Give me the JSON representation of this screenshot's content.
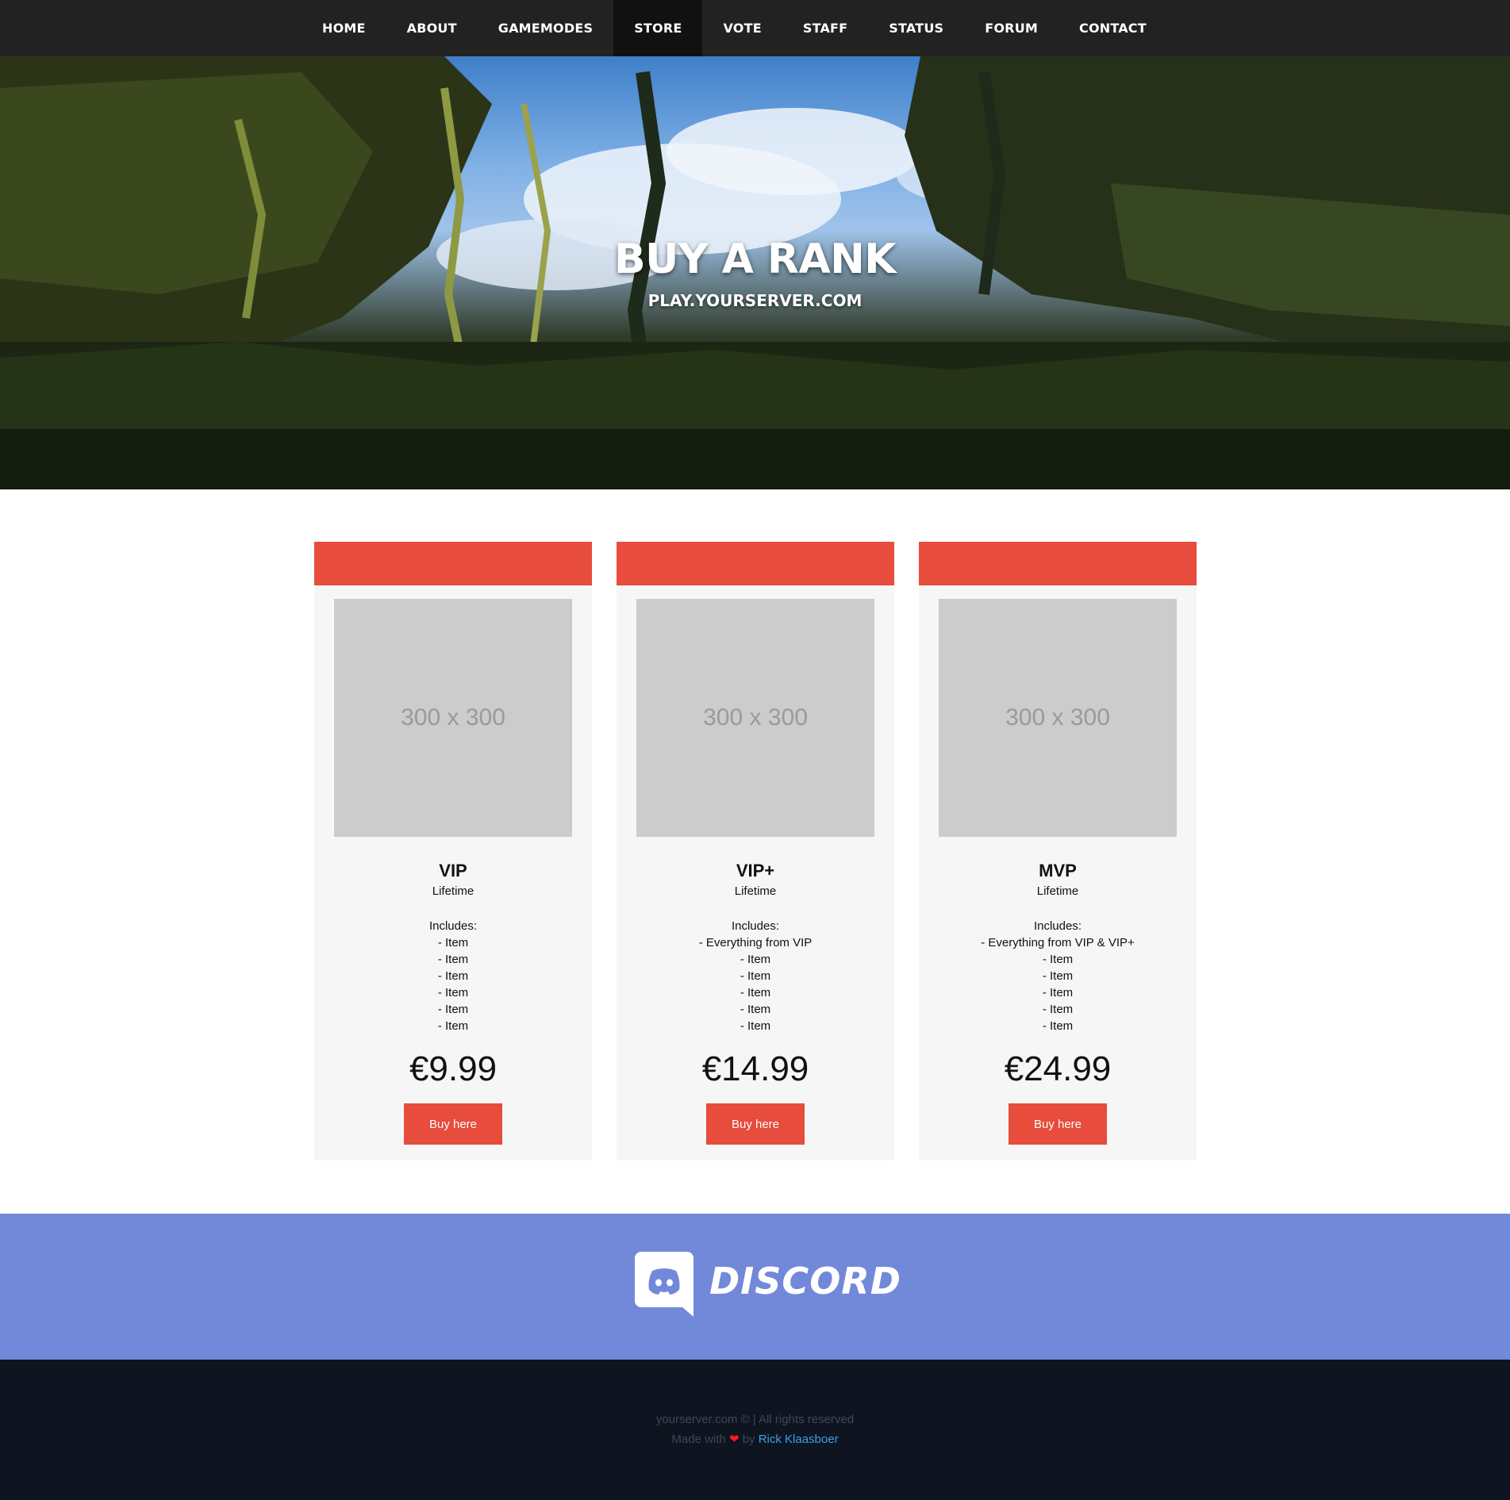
{
  "nav": {
    "items": [
      {
        "label": "HOME"
      },
      {
        "label": "ABOUT"
      },
      {
        "label": "GAMEMODES"
      },
      {
        "label": "STORE"
      },
      {
        "label": "VOTE"
      },
      {
        "label": "STAFF"
      },
      {
        "label": "STATUS"
      },
      {
        "label": "FORUM"
      },
      {
        "label": "CONTACT"
      }
    ],
    "active": "STORE"
  },
  "hero": {
    "title": "BUY A RANK",
    "subtitle": "PLAY.YOURSERVER.COM"
  },
  "cards": [
    {
      "image_placeholder": "300 x 300",
      "name": "VIP",
      "period": "Lifetime",
      "includes_label": "Includes:",
      "items": [
        "- Item",
        "- Item",
        "- Item",
        "- Item",
        "- Item",
        "- Item"
      ],
      "price": "€9.99",
      "button": "Buy here"
    },
    {
      "image_placeholder": "300 x 300",
      "name": "VIP+",
      "period": "Lifetime",
      "includes_label": "Includes:",
      "items": [
        "- Everything from VIP",
        "- Item",
        "- Item",
        "- Item",
        "- Item",
        "- Item"
      ],
      "price": "€14.99",
      "button": "Buy here"
    },
    {
      "image_placeholder": "300 x 300",
      "name": "MVP",
      "period": "Lifetime",
      "includes_label": "Includes:",
      "items": [
        "- Everything from VIP & VIP+",
        "- Item",
        "- Item",
        "- Item",
        "- Item",
        "- Item"
      ],
      "price": "€24.99",
      "button": "Buy here"
    }
  ],
  "discord": {
    "wordmark": "DISCORD",
    "color": "#7289da"
  },
  "footer": {
    "copyright": "yourserver.com © | All rights reserved",
    "made_with": "Made with",
    "by": "by",
    "author": "Rick Klaasboer",
    "heart_icon": "heart-icon"
  },
  "colors": {
    "accent": "#e74c3c",
    "nav_bg": "#222222",
    "footer_bg": "#0f1520"
  }
}
